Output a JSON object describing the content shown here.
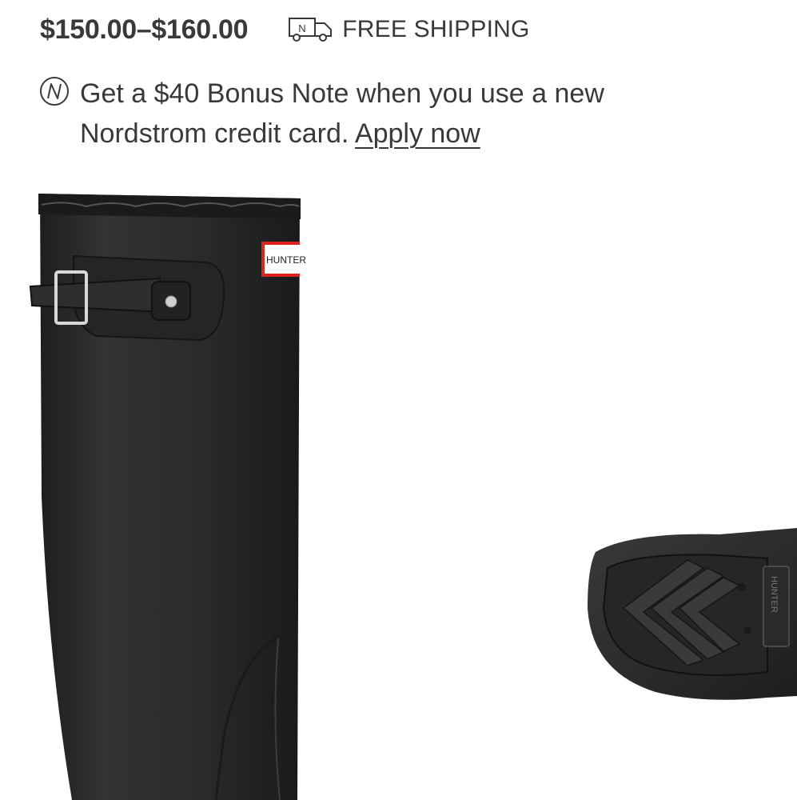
{
  "price": {
    "range": "$150.00–$160.00"
  },
  "shipping": {
    "icon": "delivery-truck-icon",
    "label": "FREE SHIPPING",
    "truck_letter": "N"
  },
  "promo": {
    "icon": "nordstrom-note-icon",
    "text_line1": "Get a $40 Bonus Note when you use a new",
    "text_line2": "Nordstrom credit card.",
    "link_label": "Apply now"
  },
  "product_image": {
    "description_icon": "boot-image",
    "brand_tag": "HUNTER",
    "sole_brand": "HUNTER"
  },
  "colors": {
    "text": "#393939",
    "boot": "#2e2e2e",
    "tag_red": "#d9251d"
  }
}
